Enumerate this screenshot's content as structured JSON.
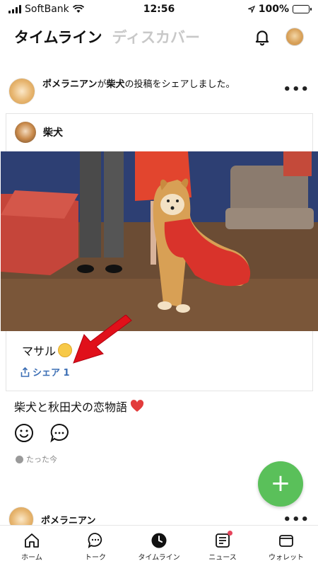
{
  "status_bar": {
    "carrier": "SoftBank",
    "time": "12:56",
    "battery": "100%"
  },
  "header": {
    "active_tab": "タイムライン",
    "inactive_tab": "ディスカバー"
  },
  "post": {
    "sharer": "ポメラニアン",
    "share_mid": "が",
    "original_author": "柴犬",
    "share_tail": "の投稿をシェアしました。",
    "card_author": "柴犬",
    "caption": "マサル",
    "share_label": "シェア 1",
    "text": "柴犬と秋田犬の恋物語",
    "timestamp": "たった今"
  },
  "next_post": {
    "author": "ポメラニアン"
  },
  "tabbar": {
    "items": [
      {
        "label": "ホーム",
        "icon": "home-icon"
      },
      {
        "label": "トーク",
        "icon": "chat-icon"
      },
      {
        "label": "タイムライン",
        "icon": "timeline-icon"
      },
      {
        "label": "ニュース",
        "icon": "news-icon"
      },
      {
        "label": "ウォレット",
        "icon": "wallet-icon"
      }
    ]
  },
  "colors": {
    "accent_green": "#5ac05a",
    "share_blue": "#3d6fb5",
    "arrow_red": "#e0101a"
  }
}
